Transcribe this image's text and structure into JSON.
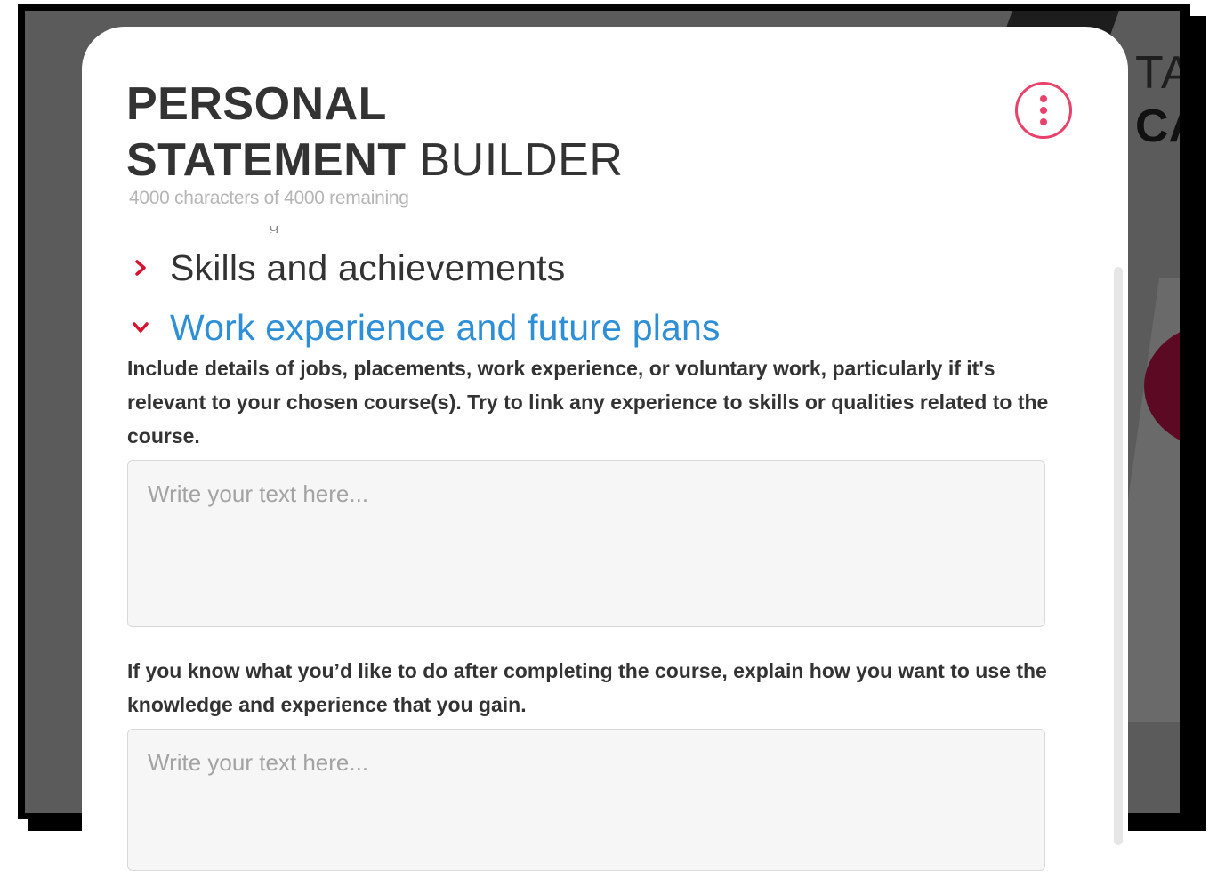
{
  "modal": {
    "title_bold_line1": "PERSONAL",
    "title_bold_line2": "STATEMENT",
    "title_light": "BUILDER",
    "char_counter": "4000 characters of 4000 remaining",
    "menu_icon": "kebab-menu-icon"
  },
  "sections": [
    {
      "label": "Skills and achievements",
      "expanded": false
    },
    {
      "label": "Work experience and future plans",
      "expanded": true
    }
  ],
  "work_experience": {
    "prompt1": "Include details of jobs, placements, work experience, or voluntary work, particularly if it's relevant to your chosen course(s). Try to link any experience to skills or qualities related to the course.",
    "placeholder1": "Write your text here...",
    "prompt2": "If you know what you’d like to do after completing the course, explain how you want to use the knowledge and experience that you gain.",
    "placeholder2": "Write your text here..."
  },
  "background": {
    "word1": "TA",
    "word2": "CA"
  },
  "colors": {
    "accent": "#e8416a",
    "chevron": "#d9122e",
    "link_blue": "#2f8fd6",
    "text": "#333333"
  }
}
